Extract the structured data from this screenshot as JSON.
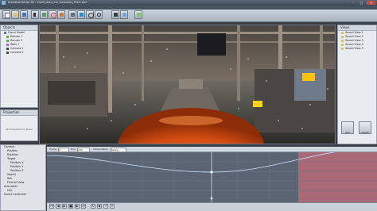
{
  "window": {
    "title": "Autodesk Recap 3D - Cloud_Auto_Car_Assembly_Plant.pts*"
  },
  "menu": {
    "tabs": [
      "File",
      "Home",
      "Edit",
      "View",
      "Animation"
    ],
    "active": 1
  },
  "objects_panel": {
    "title": "Objects",
    "items": [
      "Cloud Model",
      "Render 1",
      "Render 2",
      "Walk 1",
      "Camera 1",
      "Camera 2"
    ]
  },
  "properties_panel": {
    "title": "Properties",
    "empty_text": "No Properties to Show"
  },
  "right_panel": {
    "title": "Views",
    "items": [
      "Saved View 1",
      "Saved View 2",
      "Saved View 3",
      "Saved View 4",
      "Saved View 5"
    ],
    "buttons": [
      "Add",
      "Delete"
    ]
  },
  "timeline": {
    "field1_label": "Frame",
    "field1_value": "0",
    "field2_label": "End",
    "field2_value": "240",
    "field3_label": "Interpolation",
    "field3_value": "Spline"
  },
  "timeline_tree": {
    "items": [
      "Camera",
      "Position",
      "Rotation",
      "Target",
      "Position X",
      "Position Y",
      "Position Z",
      "Speed",
      "Roll",
      "Field of View",
      "Animation",
      "Clip",
      "Scene Controller"
    ]
  },
  "colors": {
    "accent": "#ffe000",
    "timeline_bg": "#5a6472",
    "highlight_region": "#b86a78",
    "curve": "#cde6ff"
  },
  "icons": [
    "window-icon",
    "minimize-icon",
    "maximize-icon",
    "close-icon",
    "play-icon",
    "stop-icon",
    "first-frame-icon",
    "last-frame-icon"
  ]
}
